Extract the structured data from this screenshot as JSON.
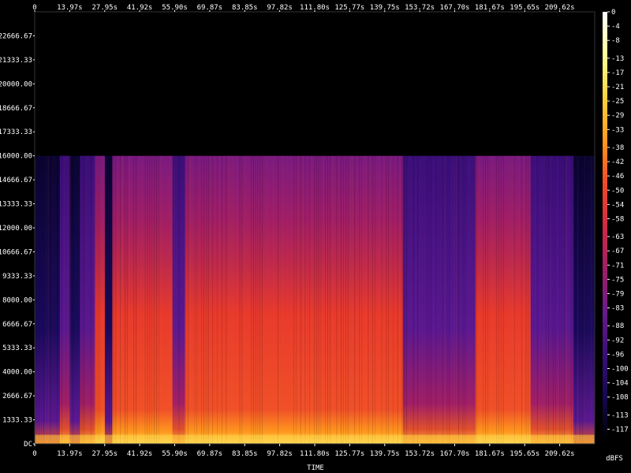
{
  "chart_data": {
    "type": "heatmap",
    "title": "",
    "xlabel": "TIME",
    "ylabel": "",
    "colorbar_label": "dBFS",
    "x_ticks": [
      "0",
      "13.97s",
      "27.95s",
      "41.92s",
      "55.90s",
      "69.87s",
      "83.85s",
      "97.82s",
      "111.80s",
      "125.77s",
      "139.75s",
      "153.72s",
      "167.70s",
      "181.67s",
      "195.65s",
      "209.62s"
    ],
    "x_tick_values": [
      0,
      13.97,
      27.95,
      41.92,
      55.9,
      69.87,
      83.85,
      97.82,
      111.8,
      125.77,
      139.75,
      153.72,
      167.7,
      181.67,
      195.65,
      209.62
    ],
    "xlim": [
      0,
      223.6
    ],
    "y_ticks": [
      "DC",
      "1333.33",
      "2666.67",
      "4000.00",
      "5333.33",
      "6666.67",
      "8000.00",
      "9333.33",
      "10666.67",
      "12000.00",
      "13333.33",
      "14666.67",
      "16000.00",
      "17333.33",
      "18666.67",
      "20000.00",
      "21333.33",
      "22666.67"
    ],
    "y_tick_values": [
      0,
      1333.33,
      2666.67,
      4000,
      5333.33,
      6666.67,
      8000,
      9333.33,
      10666.67,
      12000,
      13333.33,
      14666.67,
      16000,
      17333.33,
      18666.67,
      20000,
      21333.33,
      22666.67
    ],
    "ylim": [
      0,
      24000
    ],
    "colorbar_ticks": [
      "0",
      "-4",
      "-8",
      "-13",
      "-17",
      "-21",
      "-25",
      "-29",
      "-33",
      "-38",
      "-42",
      "-46",
      "-50",
      "-54",
      "-58",
      "-63",
      "-67",
      "-71",
      "-75",
      "-79",
      "-83",
      "-88",
      "-92",
      "-96",
      "-100",
      "-104",
      "-108",
      "-113",
      "-117"
    ],
    "colorbar_range": [
      0,
      -120
    ],
    "colormap": [
      "#ffffff",
      "#ffff9a",
      "#ffd23c",
      "#ff9a1e",
      "#f04a28",
      "#d02a44",
      "#a01e66",
      "#6a1a8a",
      "#3a0e78",
      "#140850",
      "#000000"
    ],
    "grid": false
  }
}
